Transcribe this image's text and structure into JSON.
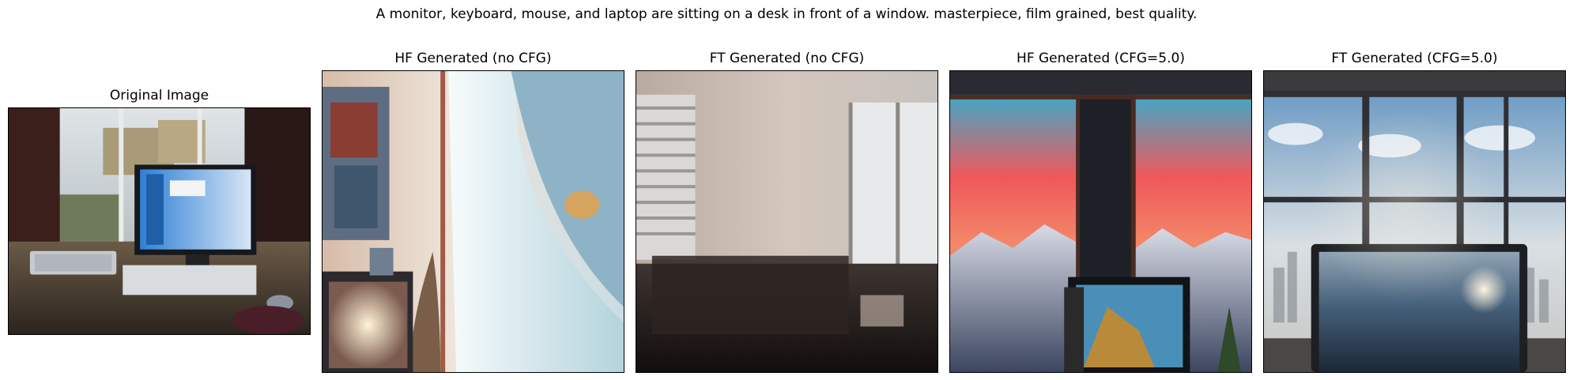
{
  "figure": {
    "caption": "A monitor, keyboard, mouse, and laptop are sitting on a desk in front of a window. masterpiece, film grained, best quality."
  },
  "panels": [
    {
      "title": "Original Image"
    },
    {
      "title": "HF Generated (no CFG)"
    },
    {
      "title": "FT Generated (no CFG)"
    },
    {
      "title": "HF Generated (CFG=5.0)"
    },
    {
      "title": "FT Generated (CFG=5.0)"
    }
  ],
  "colors": {
    "axes_frame": "#000000",
    "background": "#ffffff"
  }
}
